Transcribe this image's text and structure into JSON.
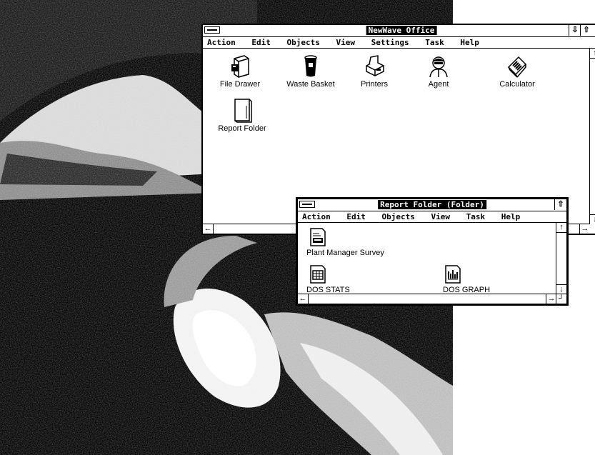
{
  "office_window": {
    "title": "NewWave Office",
    "menu": [
      "Action",
      "Edit",
      "Objects",
      "View",
      "Settings",
      "Task",
      "Help"
    ],
    "icons": [
      {
        "label": "File Drawer",
        "icon": "file-drawer-icon"
      },
      {
        "label": "Waste Basket",
        "icon": "waste-basket-icon"
      },
      {
        "label": "Printers",
        "icon": "printer-icon"
      },
      {
        "label": "Agent",
        "icon": "agent-icon"
      },
      {
        "label": "Calculator",
        "icon": "calculator-icon"
      },
      {
        "label": "Report Folder",
        "icon": "folder-icon"
      }
    ]
  },
  "folder_window": {
    "title": "Report Folder (Folder)",
    "menu": [
      "Action",
      "Edit",
      "Objects",
      "View",
      "Task",
      "Help"
    ],
    "icons": [
      {
        "label": "Plant Manager Survey",
        "icon": "document-icon"
      },
      {
        "label": "DOS STATS",
        "icon": "spreadsheet-icon"
      },
      {
        "label": "DOS GRAPH",
        "icon": "graph-icon"
      }
    ]
  }
}
